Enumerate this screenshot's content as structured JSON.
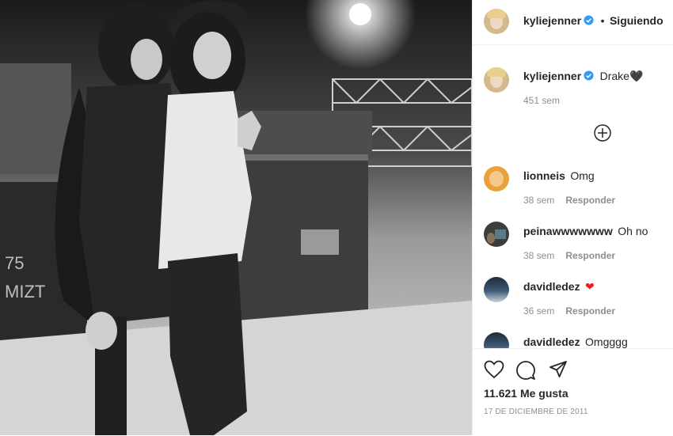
{
  "post": {
    "author": "kyliejenner",
    "follow_status": "Siguiendo",
    "separator": "•",
    "caption": "Drake🖤",
    "caption_time": "451 sem",
    "likes": "11.621 Me gusta",
    "date": "17 DE DICIEMBRE DE 2011"
  },
  "comments": [
    {
      "user": "lionneis",
      "text": "Omg",
      "time": "38 sem",
      "reply_label": "Responder"
    },
    {
      "user": "peinawwwwwww",
      "text": "Oh no",
      "time": "38 sem",
      "reply_label": "Responder"
    },
    {
      "user": "davidledez",
      "text": "❤",
      "time": "36 sem",
      "reply_label": "Responder"
    },
    {
      "user": "davidledez",
      "text": "Omgggg",
      "time": "",
      "reply_label": ""
    }
  ],
  "icons": {
    "verified": "verified-badge-icon",
    "load_more": "plus-circle-icon",
    "like": "heart-icon",
    "comment": "comment-icon",
    "share": "paper-plane-icon"
  },
  "colors": {
    "verified": "#3897f0",
    "heart": "#ed4956",
    "link": "#262626",
    "muted": "#8e8e8e"
  }
}
